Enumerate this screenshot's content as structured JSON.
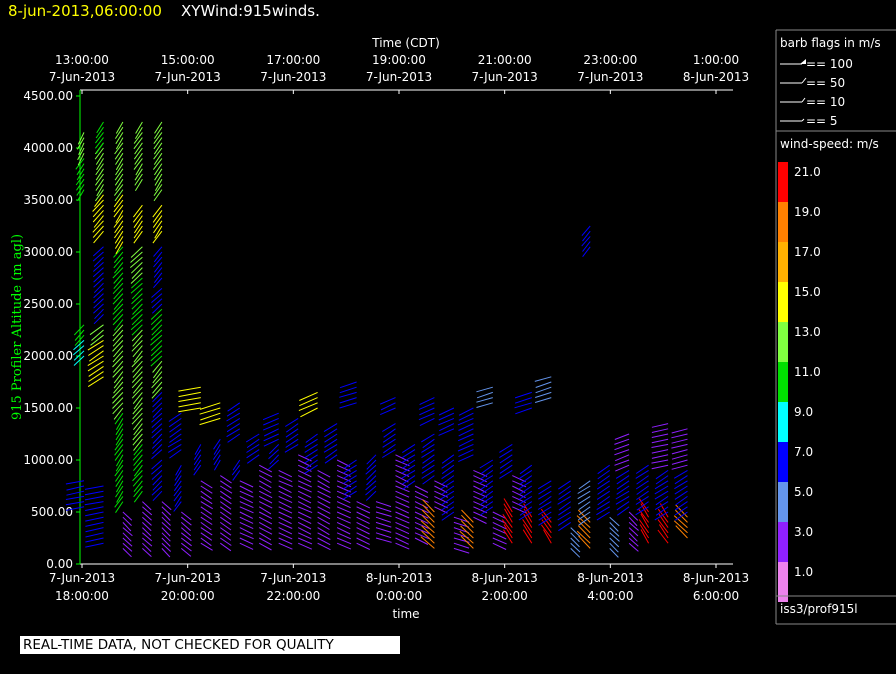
{
  "header": {
    "datetime": "8-jun-2013,06:00:00",
    "product": "XYWind:915winds.",
    "datetime_color": "#ffff00",
    "product_color": "#ffffff"
  },
  "notice": "REAL-TIME DATA, NOT CHECKED FOR QUALITY",
  "legend": {
    "barb_title": "barb flags in m/s",
    "barb_items": [
      "== 100",
      "== 50",
      "== 10",
      "== 5"
    ],
    "speed_title": "wind-speed: m/s",
    "speed_bins": [
      {
        "label": "21.0",
        "color": "#ff0000"
      },
      {
        "label": "19.0",
        "color": "#ff8000"
      },
      {
        "label": "17.0",
        "color": "#ffb000"
      },
      {
        "label": "15.0",
        "color": "#ffff00"
      },
      {
        "label": "13.0",
        "color": "#80ff40"
      },
      {
        "label": "11.0",
        "color": "#00e000"
      },
      {
        "label": "9.0",
        "color": "#00ffff"
      },
      {
        "label": "7.0",
        "color": "#0000ff"
      },
      {
        "label": "5.0",
        "color": "#6495ed"
      },
      {
        "label": "3.0",
        "color": "#9020ff"
      },
      {
        "label": "1.0",
        "color": "#ee82ee"
      }
    ],
    "source": "iss3/prof915l"
  },
  "chart_data": {
    "type": "wind-barb time-height",
    "xlabel_top": "Time (CDT)",
    "xlabel_bottom": "time",
    "ylabel": "915 Profiler Altitude (m agl)",
    "ylabel_color": "#00ff00",
    "ylim": [
      0,
      4500
    ],
    "yticks": [
      "0.00",
      "500.00",
      "1000.00",
      "1500.00",
      "2000.00",
      "2500.00",
      "3000.00",
      "3500.00",
      "4000.00",
      "4500.00"
    ],
    "top_ticks": [
      {
        "time": "13:00:00",
        "date": "7-Jun-2013"
      },
      {
        "time": "15:00:00",
        "date": "7-Jun-2013"
      },
      {
        "time": "17:00:00",
        "date": "7-Jun-2013"
      },
      {
        "time": "19:00:00",
        "date": "7-Jun-2013"
      },
      {
        "time": "21:00:00",
        "date": "7-Jun-2013"
      },
      {
        "time": "23:00:00",
        "date": "7-Jun-2013"
      },
      {
        "time": "1:00:00",
        "date": "8-Jun-2013"
      }
    ],
    "bottom_ticks": [
      {
        "date": "7-Jun-2013",
        "time": "18:00:00"
      },
      {
        "date": "7-Jun-2013",
        "time": "20:00:00"
      },
      {
        "date": "7-Jun-2013",
        "time": "22:00:00"
      },
      {
        "date": "8-Jun-2013",
        "time": "0:00:00"
      },
      {
        "date": "8-Jun-2013",
        "time": "2:00:00"
      },
      {
        "date": "8-Jun-2013",
        "time": "4:00:00"
      },
      {
        "date": "8-Jun-2013",
        "time": "6:00:00"
      }
    ],
    "profiles": [
      {
        "t": 0.0,
        "layers": [
          [
            2000,
            2150,
            8,
            240
          ],
          [
            2200,
            2300,
            10,
            245
          ],
          [
            3600,
            3900,
            11,
            250
          ],
          [
            3950,
            4150,
            13,
            255
          ],
          [
            550,
            800,
            6,
            200
          ]
        ]
      },
      {
        "t": 0.25,
        "layers": [
          [
            2200,
            2300,
            13,
            235
          ],
          [
            1800,
            2150,
            15,
            230
          ],
          [
            3200,
            3550,
            15,
            245
          ],
          [
            3600,
            4050,
            12,
            250
          ],
          [
            4050,
            4250,
            10,
            250
          ],
          [
            2400,
            3050,
            7,
            240
          ],
          [
            200,
            750,
            7,
            200
          ]
        ]
      },
      {
        "t": 0.5,
        "layers": [
          [
            150,
            500,
            3,
            300
          ],
          [
            600,
            1450,
            11,
            250
          ],
          [
            1500,
            2300,
            13,
            245
          ],
          [
            2350,
            3050,
            11,
            245
          ],
          [
            3100,
            3550,
            15,
            250
          ],
          [
            3600,
            4250,
            12,
            250
          ]
        ]
      },
      {
        "t": 0.75,
        "layers": [
          [
            150,
            600,
            3,
            300
          ],
          [
            700,
            1150,
            11,
            245
          ],
          [
            1200,
            2250,
            13,
            245
          ],
          [
            2300,
            2750,
            11,
            240
          ],
          [
            2800,
            3050,
            13,
            240
          ],
          [
            3200,
            3450,
            15,
            250
          ],
          [
            3700,
            4250,
            12,
            250
          ]
        ]
      },
      {
        "t": 1.0,
        "layers": [
          [
            150,
            600,
            3,
            300
          ],
          [
            700,
            1000,
            7,
            240
          ],
          [
            1100,
            1650,
            7,
            240
          ],
          [
            1700,
            1950,
            13,
            245
          ],
          [
            2000,
            2450,
            11,
            240
          ],
          [
            2500,
            2650,
            7,
            240
          ],
          [
            2750,
            3050,
            7,
            245
          ],
          [
            3200,
            3450,
            15,
            250
          ],
          [
            3600,
            4250,
            12,
            250
          ]
        ]
      },
      {
        "t": 1.25,
        "layers": [
          [
            150,
            500,
            3,
            305
          ],
          [
            600,
            950,
            7,
            250
          ],
          [
            1100,
            1450,
            7,
            230
          ]
        ]
      },
      {
        "t": 1.5,
        "layers": [
          [
            200,
            800,
            3,
            310
          ],
          [
            1500,
            1700,
            15,
            200
          ],
          [
            950,
            1150,
            7,
            250
          ]
        ]
      },
      {
        "t": 1.75,
        "layers": [
          [
            200,
            850,
            3,
            310
          ],
          [
            1000,
            1200,
            7,
            250
          ],
          [
            1400,
            1550,
            15,
            210
          ]
        ]
      },
      {
        "t": 2.0,
        "layers": [
          [
            200,
            800,
            3,
            320
          ],
          [
            1250,
            1550,
            7,
            230
          ],
          [
            900,
            1000,
            7,
            250
          ]
        ]
      },
      {
        "t": 2.25,
        "layers": [
          [
            200,
            950,
            3,
            315
          ],
          [
            1050,
            1250,
            7,
            230
          ]
        ]
      },
      {
        "t": 2.5,
        "layers": [
          [
            200,
            900,
            3,
            320
          ],
          [
            1000,
            1150,
            7,
            240
          ],
          [
            1200,
            1450,
            7,
            220
          ]
        ]
      },
      {
        "t": 2.75,
        "layers": [
          [
            200,
            1050,
            3,
            320
          ],
          [
            1150,
            1400,
            7,
            230
          ]
        ]
      },
      {
        "t": 3.0,
        "layers": [
          [
            200,
            900,
            3,
            315
          ],
          [
            950,
            1250,
            7,
            230
          ],
          [
            1500,
            1650,
            15,
            220
          ]
        ]
      },
      {
        "t": 3.25,
        "layers": [
          [
            200,
            1000,
            3,
            320
          ],
          [
            1050,
            1350,
            7,
            230
          ]
        ]
      },
      {
        "t": 3.5,
        "layers": [
          [
            200,
            600,
            3,
            320
          ],
          [
            700,
            1000,
            7,
            230
          ],
          [
            1550,
            1750,
            7,
            210
          ]
        ]
      },
      {
        "t": 3.75,
        "layers": [
          [
            250,
            600,
            3,
            330
          ],
          [
            700,
            1050,
            7,
            240
          ]
        ]
      },
      {
        "t": 4.0,
        "layers": [
          [
            200,
            1050,
            3,
            320
          ],
          [
            1100,
            1350,
            7,
            230
          ],
          [
            1500,
            1600,
            7,
            220
          ]
        ]
      },
      {
        "t": 4.25,
        "layers": [
          [
            250,
            750,
            3,
            320
          ],
          [
            800,
            1150,
            7,
            230
          ]
        ]
      },
      {
        "t": 4.5,
        "layers": [
          [
            150,
            500,
            19,
            120
          ],
          [
            550,
            800,
            3,
            320
          ],
          [
            850,
            1250,
            7,
            230
          ],
          [
            1400,
            1600,
            7,
            220
          ]
        ]
      },
      {
        "t": 4.75,
        "layers": [
          [
            150,
            450,
            3,
            330
          ],
          [
            500,
            1050,
            7,
            230
          ],
          [
            1300,
            1500,
            7,
            220
          ]
        ]
      },
      {
        "t": 5.0,
        "layers": [
          [
            150,
            400,
            19,
            120
          ],
          [
            450,
            900,
            3,
            320
          ],
          [
            1050,
            1500,
            7,
            220
          ]
        ]
      },
      {
        "t": 5.25,
        "layers": [
          [
            200,
            500,
            3,
            320
          ],
          [
            550,
            1000,
            7,
            230
          ],
          [
            1550,
            1700,
            5,
            210
          ]
        ]
      },
      {
        "t": 5.5,
        "layers": [
          [
            200,
            500,
            21,
            110
          ],
          [
            550,
            850,
            3,
            320
          ],
          [
            900,
            1150,
            7,
            230
          ]
        ]
      },
      {
        "t": 5.75,
        "layers": [
          [
            200,
            450,
            21,
            110
          ],
          [
            500,
            950,
            7,
            230
          ],
          [
            1500,
            1650,
            7,
            210
          ]
        ]
      },
      {
        "t": 6.0,
        "layers": [
          [
            200,
            400,
            21,
            110
          ],
          [
            450,
            800,
            7,
            230
          ],
          [
            1600,
            1800,
            5,
            210
          ]
        ]
      },
      {
        "t": 6.25,
        "layers": [
          [
            150,
            350,
            5,
            300
          ],
          [
            400,
            800,
            7,
            230
          ]
        ]
      },
      {
        "t": 6.5,
        "layers": [
          [
            150,
            400,
            19,
            120
          ],
          [
            450,
            800,
            5,
            230
          ],
          [
            3050,
            3250,
            7,
            245
          ]
        ]
      },
      {
        "t": 6.75,
        "layers": [
          [
            150,
            450,
            5,
            300
          ],
          [
            500,
            950,
            7,
            230
          ]
        ]
      },
      {
        "t": 7.0,
        "layers": [
          [
            200,
            500,
            3,
            300
          ],
          [
            550,
            900,
            7,
            230
          ],
          [
            950,
            1250,
            3,
            215
          ]
        ]
      },
      {
        "t": 7.25,
        "layers": [
          [
            200,
            500,
            21,
            110
          ],
          [
            550,
            950,
            7,
            230
          ]
        ]
      },
      {
        "t": 7.5,
        "layers": [
          [
            200,
            450,
            21,
            110
          ],
          [
            500,
            900,
            7,
            230
          ],
          [
            950,
            1350,
            3,
            200
          ]
        ]
      },
      {
        "t": 7.75,
        "layers": [
          [
            250,
            450,
            19,
            120
          ],
          [
            500,
            900,
            7,
            230
          ],
          [
            950,
            1300,
            3,
            205
          ]
        ]
      }
    ]
  }
}
